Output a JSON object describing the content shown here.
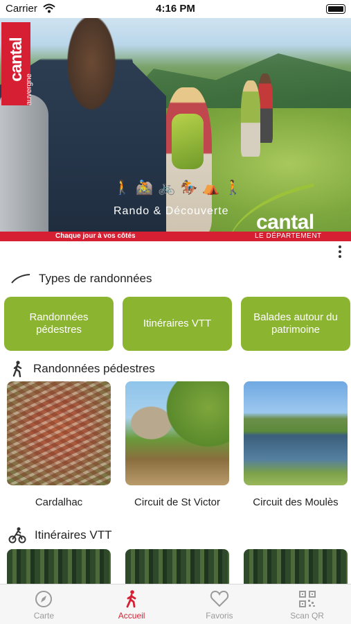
{
  "status_bar": {
    "carrier": "Carrier",
    "time": "4:16 PM"
  },
  "hero": {
    "logo_text": "cantal",
    "logo_sub": "auvergne",
    "tagline": "Rando & Découverte",
    "brand": "cantal",
    "ribbon_left": "Chaque jour à vos côtés",
    "ribbon_right": "LE DÉPARTEMENT",
    "activity_icons": [
      "hiker-icon",
      "mountain-bike-icon",
      "bicycle-icon",
      "horse-rider-icon",
      "camping-tent-icon",
      "walker-icon"
    ]
  },
  "types_section": {
    "title": "Types de randonnées",
    "buttons": [
      {
        "label": "Randonnées pédestres"
      },
      {
        "label": "Itinéraires VTT"
      },
      {
        "label": "Balades autour du patrimoine"
      }
    ]
  },
  "pedestres_section": {
    "title": "Randonnées pédestres",
    "cards": [
      {
        "title": "Cardalhac"
      },
      {
        "title": "Circuit de St Victor"
      },
      {
        "title": "Circuit des Moulès"
      }
    ]
  },
  "vtt_section": {
    "title": "Itinéraires VTT",
    "cards": [
      {
        "title": ""
      },
      {
        "title": ""
      },
      {
        "title": ""
      }
    ]
  },
  "tabbar": {
    "tabs": [
      {
        "label": "Carte",
        "icon": "compass-icon",
        "active": false
      },
      {
        "label": "Accueil",
        "icon": "hiker-icon",
        "active": true
      },
      {
        "label": "Favoris",
        "icon": "heart-icon",
        "active": false
      },
      {
        "label": "Scan QR",
        "icon": "qr-code-icon",
        "active": false
      }
    ]
  },
  "colors": {
    "brand_red": "#d61f33",
    "accent_green": "#8bb431",
    "tab_inactive": "#9a9a9a"
  }
}
